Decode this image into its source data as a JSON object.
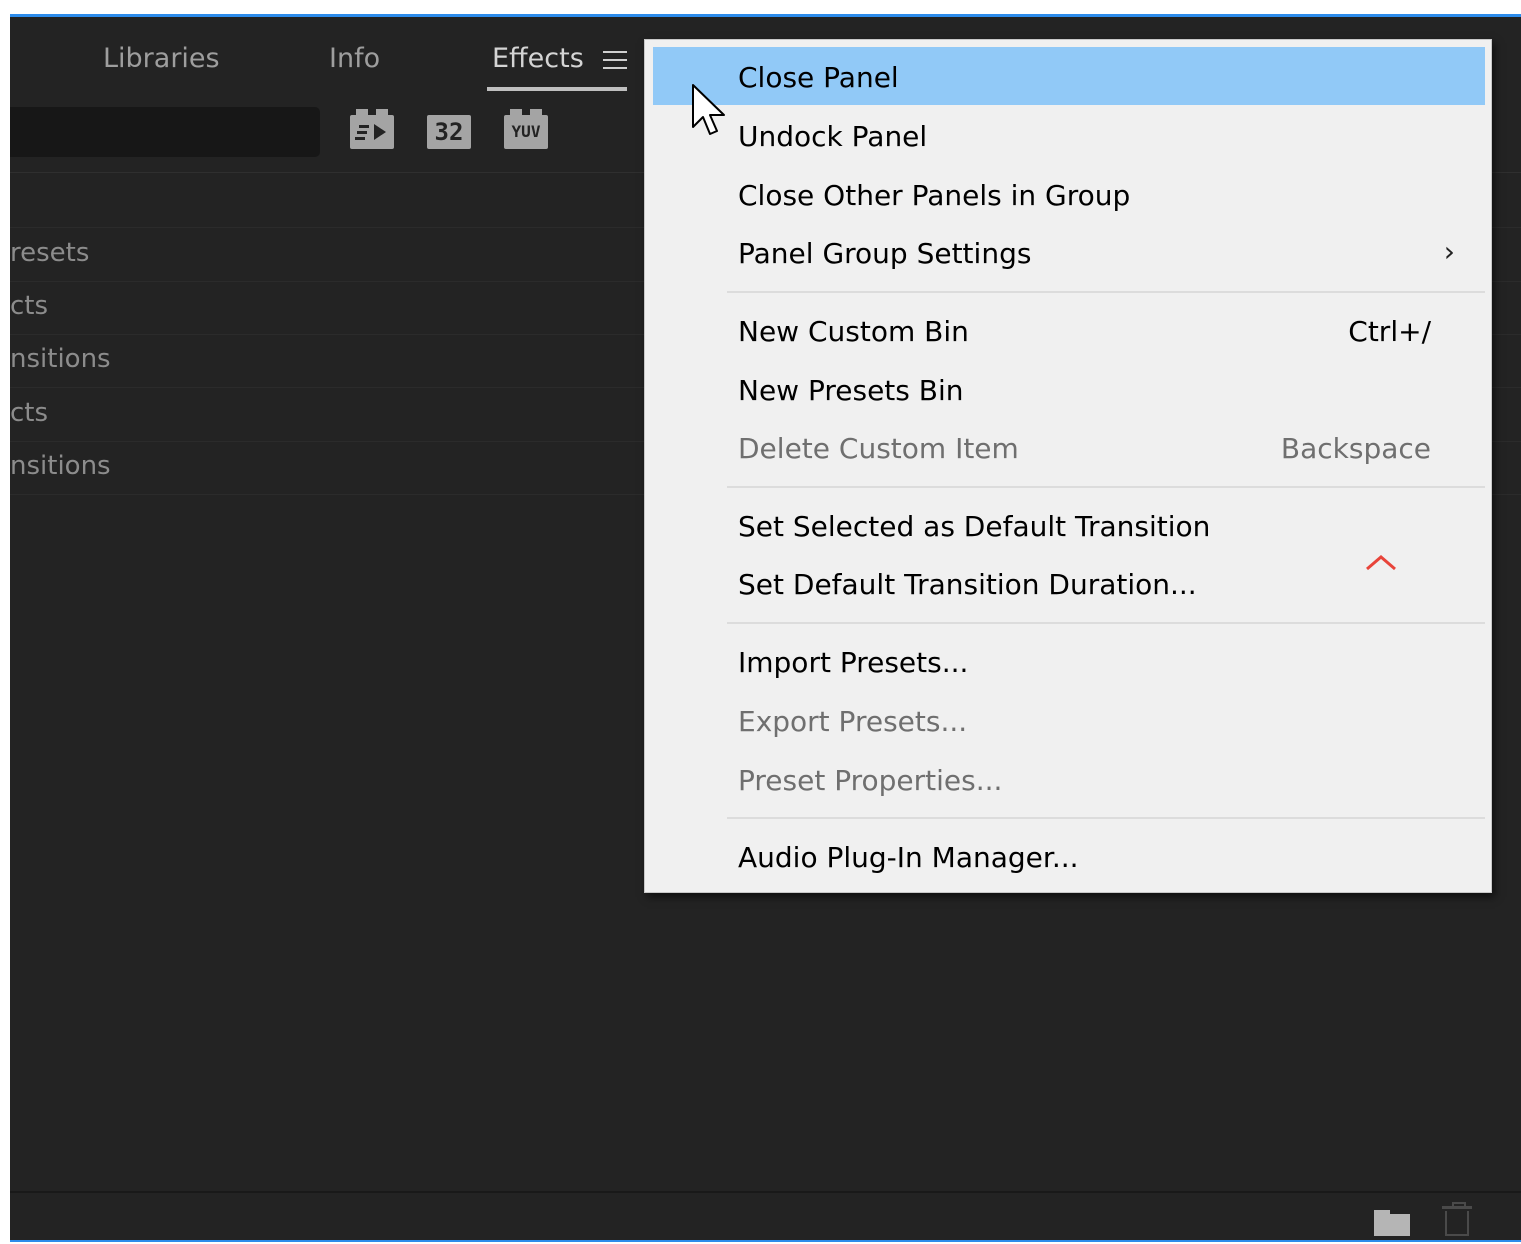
{
  "tabs": [
    {
      "label": "Libraries",
      "active": false
    },
    {
      "label": "Info",
      "active": false
    },
    {
      "label": "Effects",
      "active": true
    }
  ],
  "toolbar": {
    "icons": [
      {
        "name": "accelerated-effects-icon",
        "text": ""
      },
      {
        "name": "32-bit-color-icon",
        "text": "32"
      },
      {
        "name": "yuv-effects-icon",
        "text": "YUV"
      }
    ]
  },
  "effects_list": [
    "resets",
    "cts",
    "nsitions",
    "cts",
    "nsitions"
  ],
  "menu": {
    "items": [
      {
        "label": "Close Panel",
        "shortcut": "",
        "enabled": true,
        "highlighted": true
      },
      {
        "label": "Undock Panel",
        "shortcut": "",
        "enabled": true
      },
      {
        "label": "Close Other Panels in Group",
        "shortcut": "",
        "enabled": true
      },
      {
        "label": "Panel Group Settings",
        "shortcut": "",
        "enabled": true,
        "submenu": true,
        "submenu_glyph": "›"
      },
      {
        "label": "New Custom Bin",
        "shortcut": "Ctrl+/",
        "enabled": true
      },
      {
        "label": "New Presets Bin",
        "shortcut": "",
        "enabled": true
      },
      {
        "label": "Delete Custom Item",
        "shortcut": "Backspace",
        "enabled": false
      },
      {
        "label": "Set Selected as Default Transition",
        "shortcut": "",
        "enabled": true
      },
      {
        "label": "Set Default Transition Duration...",
        "shortcut": "",
        "enabled": true
      },
      {
        "label": "Import Presets...",
        "shortcut": "",
        "enabled": true
      },
      {
        "label": "Export Presets...",
        "shortcut": "",
        "enabled": false
      },
      {
        "label": "Preset Properties...",
        "shortcut": "",
        "enabled": false
      },
      {
        "label": "Audio Plug-In Manager...",
        "shortcut": "",
        "enabled": true
      }
    ]
  },
  "colors": {
    "panel_bg": "#232323",
    "accent_blue": "#2d8ceb",
    "menu_bg": "#f0f0f0",
    "menu_highlight": "#91c9f7",
    "disabled_text": "#6f6f6f",
    "chevron_red": "#e8443a"
  },
  "footer": {
    "icons": [
      "new-bin-folder-icon",
      "delete-trash-icon"
    ]
  }
}
